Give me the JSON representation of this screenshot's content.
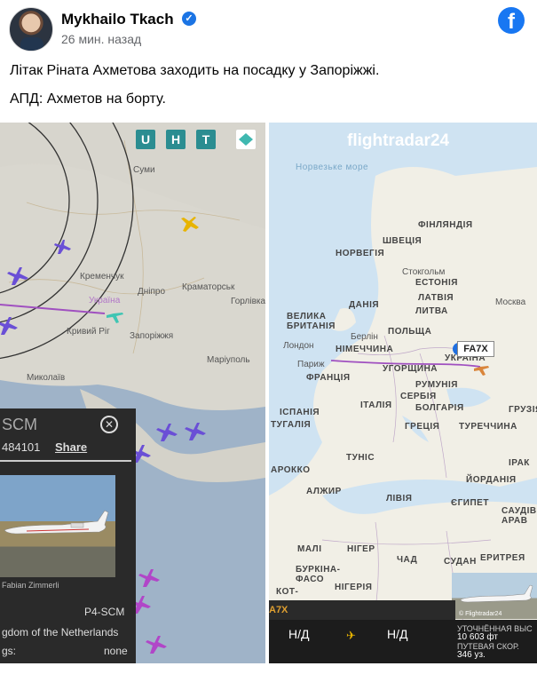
{
  "post": {
    "author": "Mykhailo Tkach",
    "time": "26 мин. назад",
    "line1": "Літак Ріната Ахметова заходить на посадку у Запоріжжі.",
    "line2": "АПД: Ахметов на борту."
  },
  "icons": {
    "verified": "verified-badge-icon",
    "facebook": "facebook-logo-icon"
  },
  "left_image": {
    "controls": [
      "U",
      "H",
      "T"
    ],
    "map_labels": [
      "Суми",
      "Україна",
      "Кривий Ріг",
      "Запоріжжя",
      "Краматорськ",
      "Маріуполь",
      "Миколаїв",
      "Дніпро",
      "Кременчук",
      "Горлівка"
    ],
    "panel": {
      "reg": "SCM",
      "id": "484101",
      "share": "Share",
      "photo_credit": "Fabian Zimmerli",
      "model": "P4-SCM",
      "country": "gdom of the Netherlands",
      "flags_label": "gs:",
      "flags_value": "none"
    }
  },
  "right_image": {
    "logo": "flightradar24",
    "map_labels": [
      "Норвезьке море",
      "ФІНЛЯНДІЯ",
      "ШВЕЦІЯ",
      "НОРВЕГІЯ",
      "Стокгольм",
      "ЕСТОНІЯ",
      "ЛАТВІЯ",
      "ДАНІЯ",
      "ЛИТВА",
      "Москва",
      "ВЕЛИКА БРИТАНІЯ",
      "Берлін",
      "ПОЛЬЩА",
      "Лондон",
      "НІМЕЧЧИНА",
      "Париж",
      "УКРАЇНА",
      "ФРАНЦІЯ",
      "УГОРЩИНА",
      "РУМУНІЯ",
      "СЕРБІЯ",
      "ІТАЛІЯ",
      "БОЛГАРІЯ",
      "ІСПАНІЯ",
      "ГРУЗІЯ",
      "ТУГАЛІЯ",
      "ГРЕЦІЯ",
      "ТУРЕЧЧИНА",
      "ТУНІС",
      "АРОККО",
      "ІРАК",
      "АЛЖИР",
      "ЙОРДАНІЯ",
      "ЛІВІЯ",
      "ЄГИПЕТ",
      "САУДІВ АРАВ",
      "МАЛІ",
      "НІГЕР",
      "ЧАД",
      "СУДАН",
      "ЕРИТРЕЯ",
      "БУРКІНА-ФАСО",
      "НІГЕРІЯ",
      "КОТ-"
    ],
    "flight_badge": "FA7X",
    "strip_text": "A7X",
    "nd_left": "Н/Д",
    "nd_right": "Н/Д",
    "altitude_lines": [
      "УТОЧНЁННАЯ ВЫС",
      "10 603 фт",
      "ПУТЕВАЯ СКОР.",
      "346 уз."
    ],
    "thumb_credit": "© Flightradar24"
  }
}
